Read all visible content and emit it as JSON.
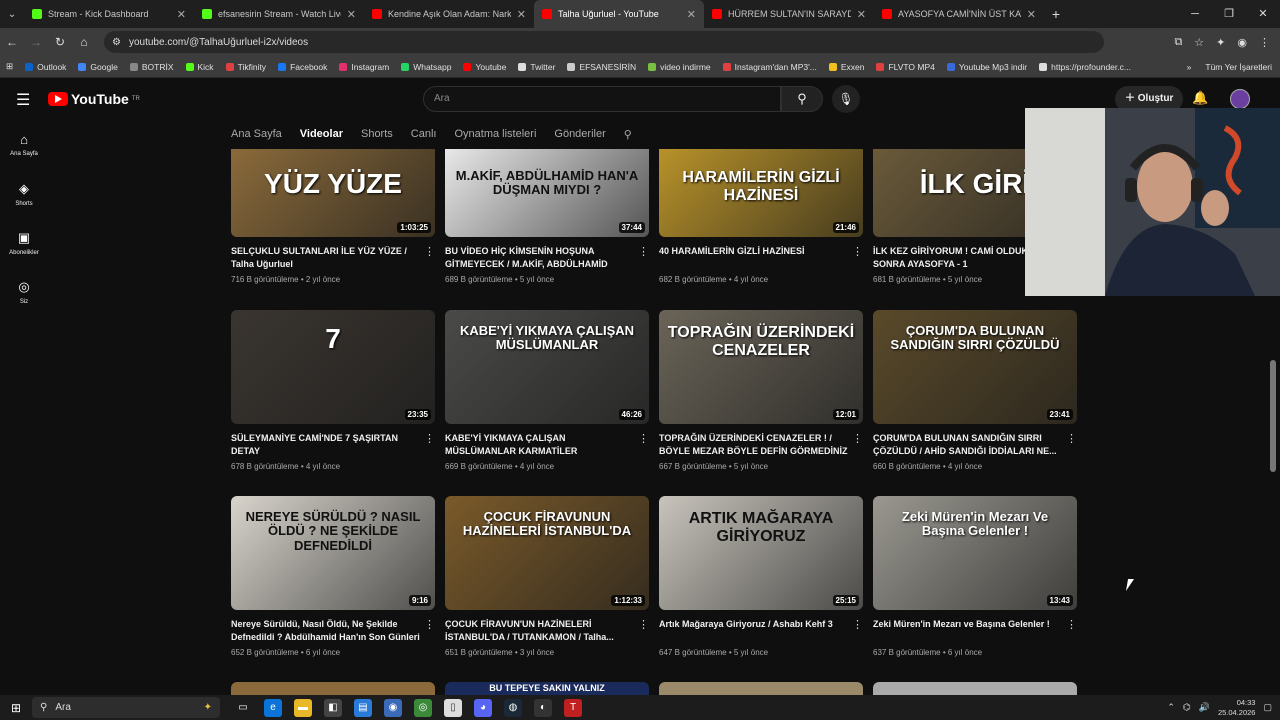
{
  "browser": {
    "tabs": [
      {
        "label": "Stream - Kick Dashboard",
        "color": "#53fc18"
      },
      {
        "label": "efsanesirin Stream - Watch Live",
        "color": "#53fc18"
      },
      {
        "label": "Kendine Aşık Olan Adam: Nark",
        "color": "#ff0000"
      },
      {
        "label": "Talha Uğurluel - YouTube",
        "color": "#ff0000"
      },
      {
        "label": "HÜRREM SULTAN'IN SARAYDA",
        "color": "#ff0000"
      },
      {
        "label": "AYASOFYA CAMİ'NİN ÜST KAT",
        "color": "#ff0000"
      }
    ],
    "url": "youtube.com/@TalhaUğurluel-i2x/videos",
    "bookmarks": [
      "Outlook",
      "Google",
      "BOTRİX",
      "Kick",
      "Tikfinity",
      "Facebook",
      "Instagram",
      "Whatsapp",
      "Youtube",
      "Twitter",
      "EFSANESİRİN",
      "video indirme",
      "Instagram'dan MP3'...",
      "Exxen",
      "FLVTO MP4",
      "Youtube Mp3 indir",
      "https://profounder.c..."
    ],
    "bookmarks_other": "Tüm Yer İşaretleri"
  },
  "youtube": {
    "logo": "YouTube",
    "logo_sup": "TR",
    "search_placeholder": "Ara",
    "create_label": "Oluştur",
    "sidebar": [
      "Ana Sayfa",
      "Shorts",
      "Abonelikler",
      "Siz"
    ],
    "channel_tabs": [
      "Ana Sayfa",
      "Videolar",
      "Shorts",
      "Canlı",
      "Oynatma listeleri",
      "Gönderiler"
    ],
    "videos": [
      {
        "title": "SELÇUKLU SULTANLARI İLE YÜZ YÜZE / Talha Uğurluel",
        "meta": "716 B görüntüleme • 2 yıl önce",
        "duration": "1:03:25",
        "thumb_text": "YÜZ YÜZE",
        "bg": "#8a6a3a"
      },
      {
        "title": "BU VİDEO HİÇ KİMSENİN HOŞUNA GİTMEYECEK / M.AKİF, ABDÜLHAMİD HAN'...",
        "meta": "689 B görüntüleme • 5 yıl önce",
        "duration": "37:44",
        "thumb_text": "M.AKİF, ABDÜLHAMİD HAN'A DÜŞMAN MIYDI ?",
        "bg": "#e8e8e8"
      },
      {
        "title": "40 HARAMİLERİN GİZLİ HAZİNESİ",
        "meta": "682 B görüntüleme • 4 yıl önce",
        "duration": "21:46",
        "thumb_text": "HARAMİLERİN GİZLİ HAZİNESİ",
        "bg": "#b8922a"
      },
      {
        "title": "İLK KEZ GİRİYORUM ! CAMİ OLDUKTAN SONRA AYASOFYA - 1",
        "meta": "681 B görüntüleme • 5 yıl önce",
        "duration": "",
        "thumb_text": "İLK GİRİ",
        "bg": "#6a5a3a"
      },
      {
        "title": "SÜLEYMANİYE CAMİ'NDE 7 ŞAŞIRTAN DETAY",
        "meta": "678 B görüntüleme • 4 yıl önce",
        "duration": "23:35",
        "thumb_text": "7",
        "bg": "#3a3530"
      },
      {
        "title": "KABE'Yİ YIKMAYA ÇALIŞAN MÜSLÜMANLAR KARMATİLER",
        "meta": "669 B görüntüleme • 4 yıl önce",
        "duration": "46:26",
        "thumb_text": "KABE'Yİ YIKMAYA ÇALIŞAN MÜSLÜMANLAR",
        "bg": "#4a4a48"
      },
      {
        "title": "TOPRAĞIN ÜZERİNDEKİ CENAZELER ! / BÖYLE MEZAR BÖYLE DEFİN GÖRMEDİNİZ !",
        "meta": "667 B görüntüleme • 5 yıl önce",
        "duration": "12:01",
        "thumb_text": "TOPRAĞIN ÜZERİNDEKİ CENAZELER",
        "bg": "#6a6458"
      },
      {
        "title": "ÇORUM'DA BULUNAN SANDIĞIN SIRRI ÇÖZÜLDÜ / AHİD SANDIĞI İDDİALARI NE...",
        "meta": "660 B görüntüleme • 4 yıl önce",
        "duration": "23:41",
        "thumb_text": "ÇORUM'DA BULUNAN SANDIĞIN SIRRI ÇÖZÜLDÜ",
        "bg": "#5a4a2a"
      },
      {
        "title": "Nereye Sürüldü, Nasıl Öldü, Ne Şekilde Defnedildi ? Abdülhamid Han'ın Son Günleri",
        "meta": "652 B görüntüleme • 6 yıl önce",
        "duration": "9:16",
        "thumb_text": "NEREYE SÜRÜLDÜ ? NASIL ÖLDÜ ? NE ŞEKİLDE DEFNEDİLDİ",
        "bg": "#d8d4cc"
      },
      {
        "title": "ÇOCUK FİRAVUN'UN HAZİNELERİ İSTANBUL'DA / TUTANKAMON / Talha...",
        "meta": "651 B görüntüleme • 3 yıl önce",
        "duration": "1:12:33",
        "thumb_text": "ÇOCUK FİRAVUNUN HAZİNELERİ İSTANBUL'DA",
        "bg": "#7a5a2a"
      },
      {
        "title": "Artık Mağaraya Giriyoruz / Ashabı Kehf 3",
        "meta": "647 B görüntüleme • 5 yıl önce",
        "duration": "25:15",
        "thumb_text": "ARTIK MAĞARAYA GİRİYORUZ",
        "bg": "#c8c4bc"
      },
      {
        "title": "Zeki Müren'in Mezarı ve Başına Gelenler !",
        "meta": "637 B görüntüleme • 6 yıl önce",
        "duration": "13:43",
        "thumb_text": "Zeki Müren'in Mezarı Ve Başına Gelenler !",
        "bg": "#9a9890"
      }
    ],
    "partial_row_text": "BU TEPEYE SAKIN YALNIZ"
  },
  "taskbar": {
    "search_placeholder": "Ara",
    "time": "04:33",
    "date": "25.04.2026"
  }
}
